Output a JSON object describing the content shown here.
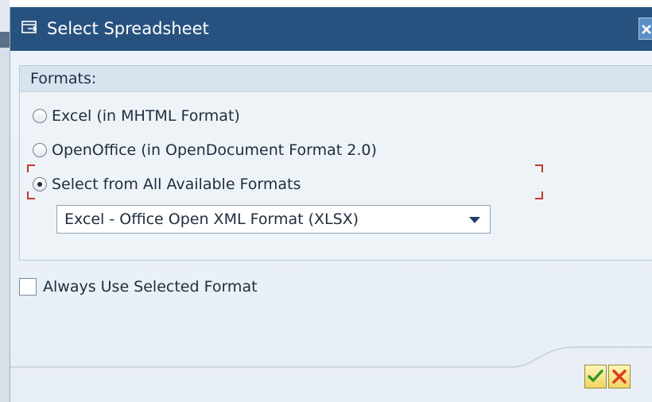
{
  "dialog": {
    "title": "Select Spreadsheet",
    "title_icon": "select-dialog-icon",
    "close_icon": "close-icon"
  },
  "formats": {
    "group_label": "Formats:",
    "options": [
      {
        "label": "Excel (in MHTML Format)",
        "checked": false
      },
      {
        "label": "OpenOffice (in OpenDocument Format 2.0)",
        "checked": false
      },
      {
        "label": "Select from All Available Formats",
        "checked": true
      }
    ],
    "dropdown": {
      "selected": "Excel - Office Open XML Format (XLSX)"
    }
  },
  "always_use": {
    "label": "Always Use Selected Format",
    "checked": false
  },
  "buttons": {
    "ok_icon": "checkmark-icon",
    "cancel_icon": "cancel-x-icon"
  },
  "colors": {
    "titlebar": "#27527f",
    "focus_frame": "#c0392b",
    "button_face": "#f1d560"
  }
}
